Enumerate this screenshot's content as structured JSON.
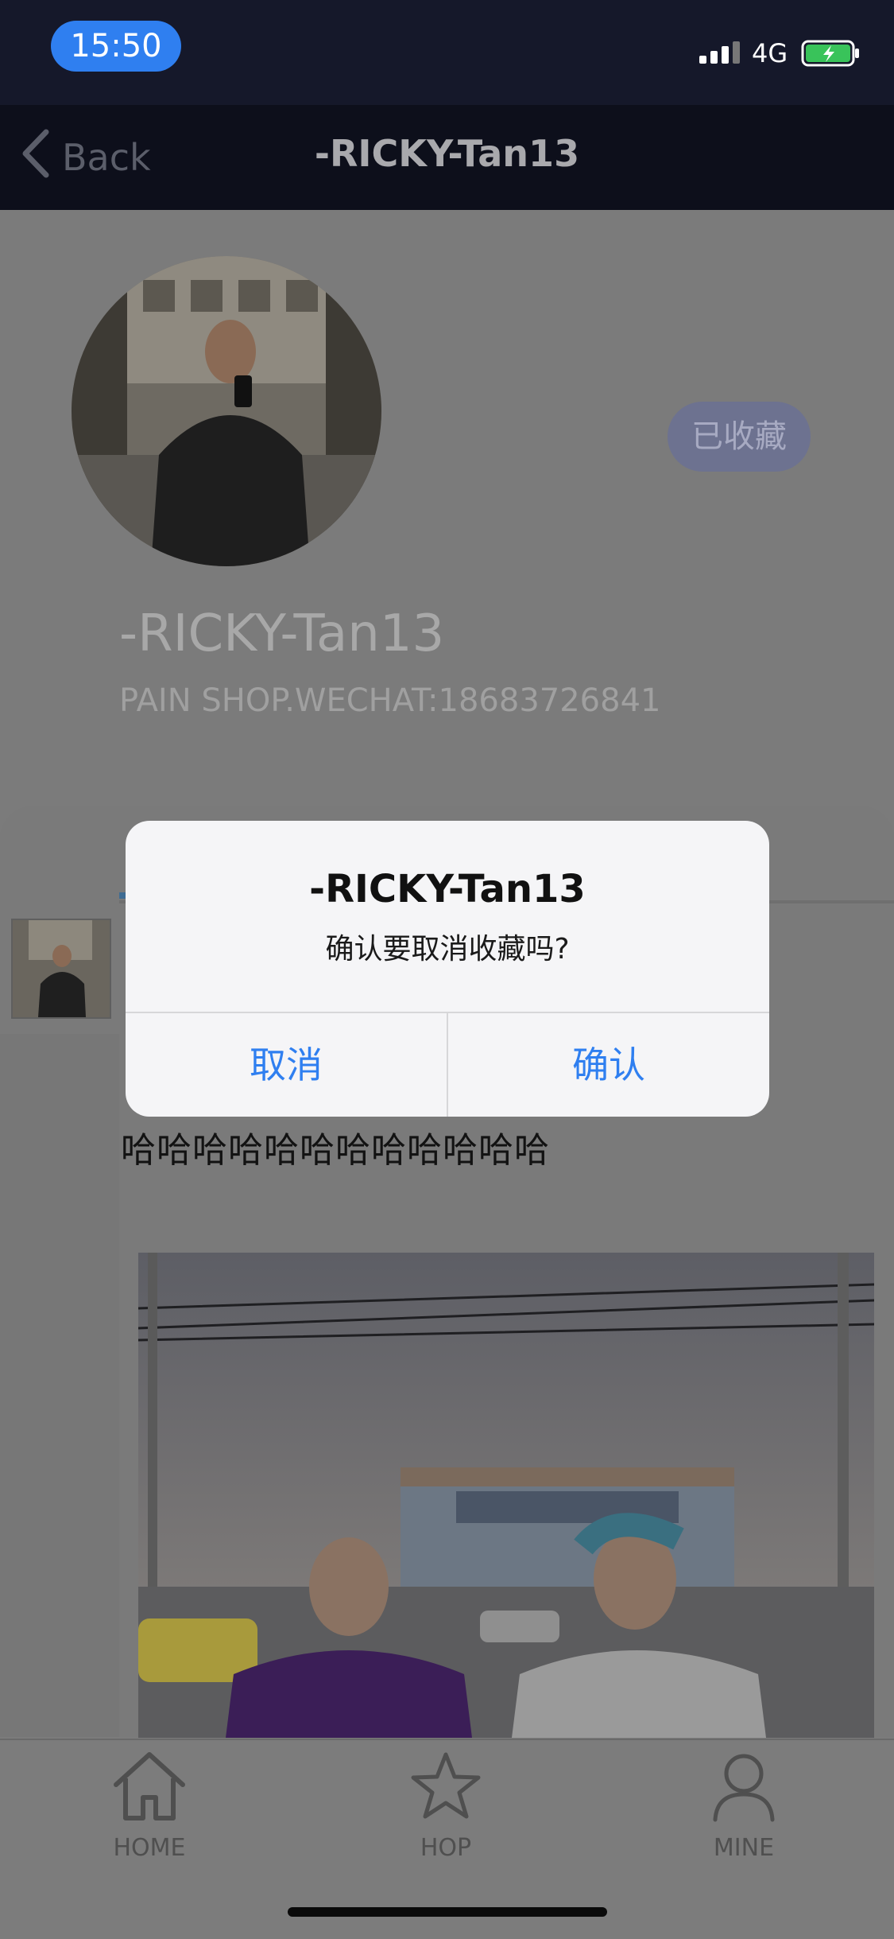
{
  "status_bar": {
    "time": "15:50",
    "network": "4G",
    "signal_icon": "signal-bars-icon",
    "battery_icon": "battery-charging-icon"
  },
  "nav": {
    "back_label": "Back",
    "title": "-RICKY-Tan13",
    "back_icon": "chevron-left-icon"
  },
  "profile": {
    "favorite_badge": "已收藏",
    "name": "-RICKY-Tan13",
    "bio": "PAIN SHOP.WECHAT:18683726841"
  },
  "post": {
    "text": "哈哈哈哈哈哈哈哈哈哈哈哈"
  },
  "alert": {
    "title": "-RICKY-Tan13",
    "message": "确认要取消收藏吗?",
    "cancel_label": "取消",
    "confirm_label": "确认"
  },
  "tab_bar": {
    "items": [
      {
        "label": "HOME",
        "icon": "house-icon"
      },
      {
        "label": "HOP",
        "icon": "star-icon"
      },
      {
        "label": "MINE",
        "icon": "person-icon"
      }
    ]
  },
  "colors": {
    "accent": "#2f7ff0",
    "status_bar_bg": "#15182a",
    "nav_bg": "#0d0f1b",
    "dim_bg": "#7b7b7b"
  }
}
